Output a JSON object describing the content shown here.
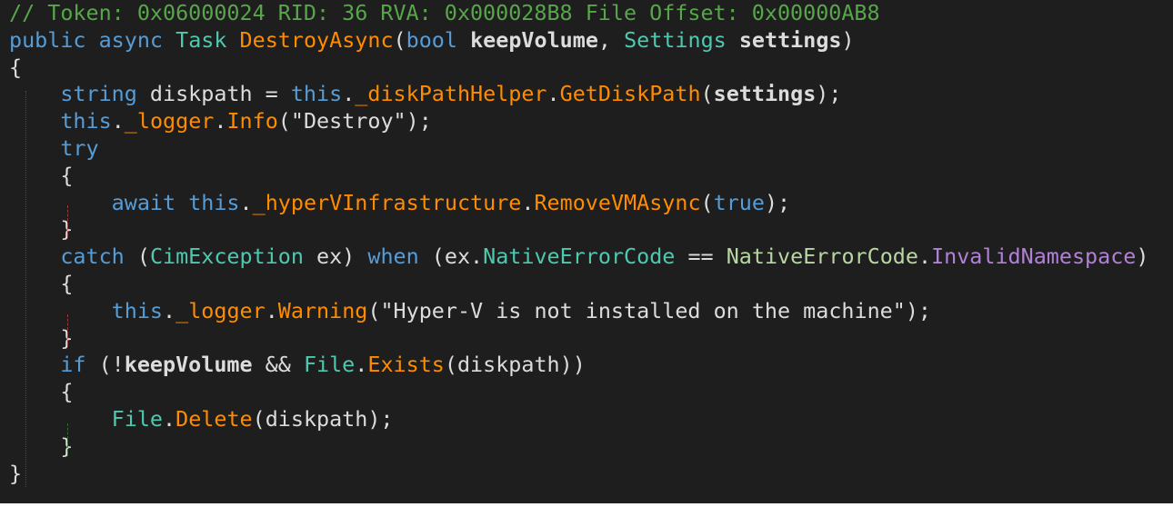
{
  "colors": {
    "background": "#1e1e1e",
    "default": "#dcdcdc",
    "comment": "#57a64a",
    "keyword": "#569cd6",
    "type": "#4ec9b0",
    "method": "#ff8c00",
    "field": "#9cdcfe",
    "string": "#d69d85",
    "enum_member": "#b8d7a3",
    "property": "#4ec9b0",
    "enum_value": "#b180d7",
    "param": "#dcdcdc"
  },
  "code": {
    "lines": [
      [
        {
          "t": "// Token: 0x06000024 RID: 36 RVA: 0x000028B8 File Offset: 0x00000AB8",
          "c": "comment"
        }
      ],
      [
        {
          "t": "public",
          "c": "keyword"
        },
        {
          "t": " ",
          "c": "default"
        },
        {
          "t": "async",
          "c": "keyword"
        },
        {
          "t": " ",
          "c": "default"
        },
        {
          "t": "Task",
          "c": "type"
        },
        {
          "t": " ",
          "c": "default"
        },
        {
          "t": "DestroyAsync",
          "c": "method"
        },
        {
          "t": "(",
          "c": "default"
        },
        {
          "t": "bool",
          "c": "keyword"
        },
        {
          "t": " ",
          "c": "default"
        },
        {
          "t": "keepVolume",
          "c": "param",
          "b": true
        },
        {
          "t": ", ",
          "c": "default"
        },
        {
          "t": "Settings",
          "c": "type"
        },
        {
          "t": " ",
          "c": "default"
        },
        {
          "t": "settings",
          "c": "param",
          "b": true
        },
        {
          "t": ")",
          "c": "default"
        }
      ],
      [
        {
          "t": "{",
          "c": "default"
        }
      ],
      [
        {
          "t": "    ",
          "c": "default"
        },
        {
          "t": "string",
          "c": "keyword"
        },
        {
          "t": " diskpath = ",
          "c": "default"
        },
        {
          "t": "this",
          "c": "keyword"
        },
        {
          "t": ".",
          "c": "default"
        },
        {
          "t": "_diskPathHelper",
          "c": "method"
        },
        {
          "t": ".",
          "c": "default"
        },
        {
          "t": "GetDiskPath",
          "c": "method"
        },
        {
          "t": "(",
          "c": "default"
        },
        {
          "t": "settings",
          "c": "param",
          "b": true
        },
        {
          "t": ");",
          "c": "default"
        }
      ],
      [
        {
          "t": "    ",
          "c": "default"
        },
        {
          "t": "this",
          "c": "keyword"
        },
        {
          "t": ".",
          "c": "default"
        },
        {
          "t": "_logger",
          "c": "method"
        },
        {
          "t": ".",
          "c": "default"
        },
        {
          "t": "Info",
          "c": "method"
        },
        {
          "t": "(",
          "c": "default"
        },
        {
          "t": "\"Destroy\"",
          "c": "default"
        },
        {
          "t": ");",
          "c": "default"
        }
      ],
      [
        {
          "t": "    ",
          "c": "default"
        },
        {
          "t": "try",
          "c": "keyword"
        }
      ],
      [
        {
          "t": "    {",
          "c": "default"
        }
      ],
      [
        {
          "t": "        ",
          "c": "default"
        },
        {
          "t": "await",
          "c": "keyword"
        },
        {
          "t": " ",
          "c": "default"
        },
        {
          "t": "this",
          "c": "keyword"
        },
        {
          "t": ".",
          "c": "default"
        },
        {
          "t": "_hyperVInfrastructure",
          "c": "method"
        },
        {
          "t": ".",
          "c": "default"
        },
        {
          "t": "RemoveVMAsync",
          "c": "method"
        },
        {
          "t": "(",
          "c": "default"
        },
        {
          "t": "true",
          "c": "keyword"
        },
        {
          "t": ");",
          "c": "default"
        }
      ],
      [
        {
          "t": "    }",
          "c": "default"
        }
      ],
      [
        {
          "t": "    ",
          "c": "default"
        },
        {
          "t": "catch",
          "c": "keyword"
        },
        {
          "t": " (",
          "c": "default"
        },
        {
          "t": "CimException",
          "c": "type"
        },
        {
          "t": " ex) ",
          "c": "default"
        },
        {
          "t": "when",
          "c": "keyword"
        },
        {
          "t": " (ex.",
          "c": "default"
        },
        {
          "t": "NativeErrorCode",
          "c": "property"
        },
        {
          "t": " == ",
          "c": "default"
        },
        {
          "t": "NativeErrorCode",
          "c": "enum_member"
        },
        {
          "t": ".",
          "c": "default"
        },
        {
          "t": "InvalidNamespace",
          "c": "enum_value"
        },
        {
          "t": ")",
          "c": "default"
        }
      ],
      [
        {
          "t": "    {",
          "c": "default"
        }
      ],
      [
        {
          "t": "        ",
          "c": "default"
        },
        {
          "t": "this",
          "c": "keyword"
        },
        {
          "t": ".",
          "c": "default"
        },
        {
          "t": "_logger",
          "c": "method"
        },
        {
          "t": ".",
          "c": "default"
        },
        {
          "t": "Warning",
          "c": "method"
        },
        {
          "t": "(",
          "c": "default"
        },
        {
          "t": "\"Hyper-V is not installed on the machine\"",
          "c": "default"
        },
        {
          "t": ");",
          "c": "default"
        }
      ],
      [
        {
          "t": "    }",
          "c": "default"
        }
      ],
      [
        {
          "t": "    ",
          "c": "default"
        },
        {
          "t": "if",
          "c": "keyword"
        },
        {
          "t": " (!",
          "c": "default"
        },
        {
          "t": "keepVolume",
          "c": "param",
          "b": true
        },
        {
          "t": " && ",
          "c": "default"
        },
        {
          "t": "File",
          "c": "type"
        },
        {
          "t": ".",
          "c": "default"
        },
        {
          "t": "Exists",
          "c": "method"
        },
        {
          "t": "(diskpath))",
          "c": "default"
        }
      ],
      [
        {
          "t": "    {",
          "c": "default"
        }
      ],
      [
        {
          "t": "        ",
          "c": "default"
        },
        {
          "t": "File",
          "c": "type"
        },
        {
          "t": ".",
          "c": "default"
        },
        {
          "t": "Delete",
          "c": "method"
        },
        {
          "t": "(diskpath);",
          "c": "default"
        }
      ],
      [
        {
          "t": "    }",
          "c": "default"
        }
      ],
      [
        {
          "t": "}",
          "c": "default"
        }
      ]
    ]
  }
}
